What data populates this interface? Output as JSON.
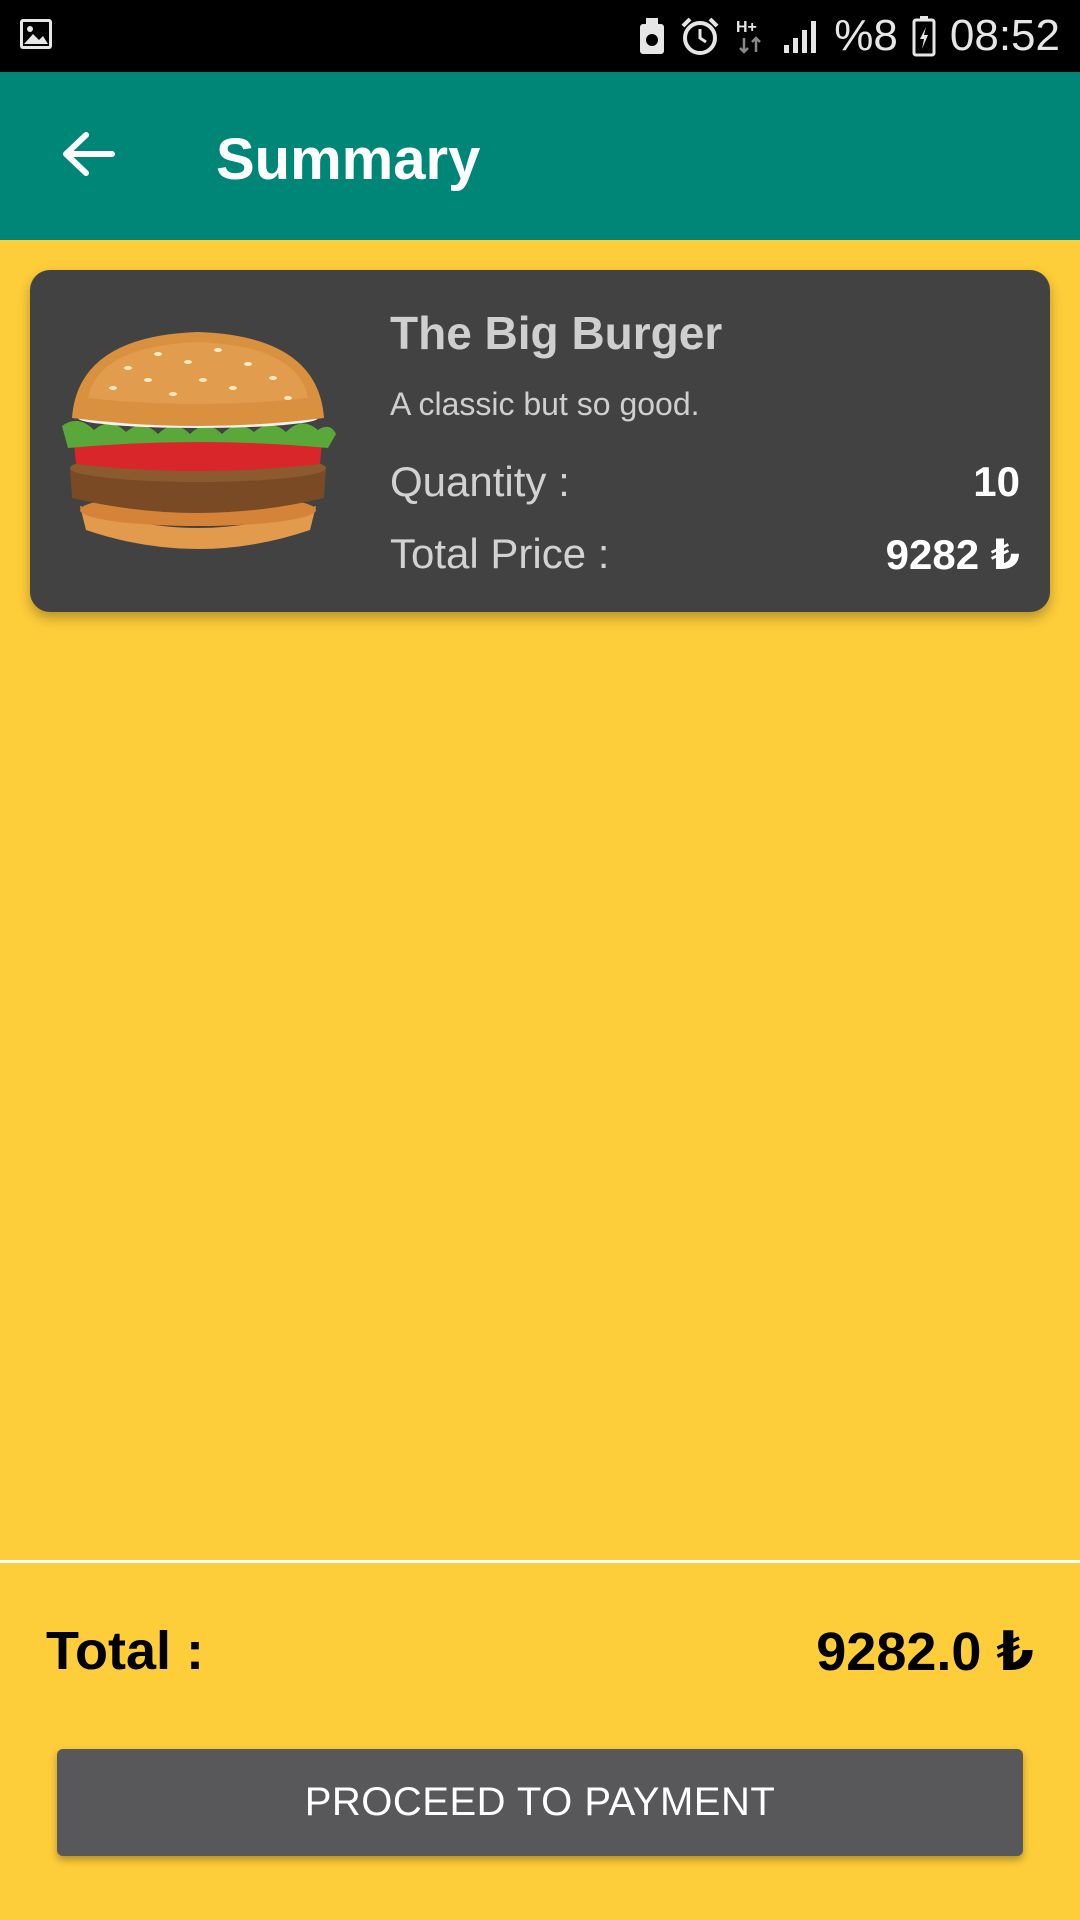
{
  "status_bar": {
    "battery_percent": "%8",
    "time": "08:52",
    "network": "H+",
    "icons": [
      "image-icon",
      "usb-icon",
      "alarm-icon",
      "network-h-plus-icon",
      "signal-icon",
      "battery-icon"
    ]
  },
  "app_bar": {
    "title": "Summary",
    "back_icon": "back-arrow-icon",
    "color": "#008677"
  },
  "items": [
    {
      "name": "The Big Burger",
      "description": "A classic but so good.",
      "quantity_label": "Quantity :",
      "quantity": "10",
      "price_label": "Total Price :",
      "price": "9282 ₺",
      "image": "burger-image"
    }
  ],
  "summary": {
    "total_label": "Total :",
    "total_value": "9282.0 ₺"
  },
  "actions": {
    "pay_label": "PROCEED TO PAYMENT"
  },
  "colors": {
    "background": "#FDCD3A",
    "card": "#424242",
    "button": "#58585A"
  }
}
